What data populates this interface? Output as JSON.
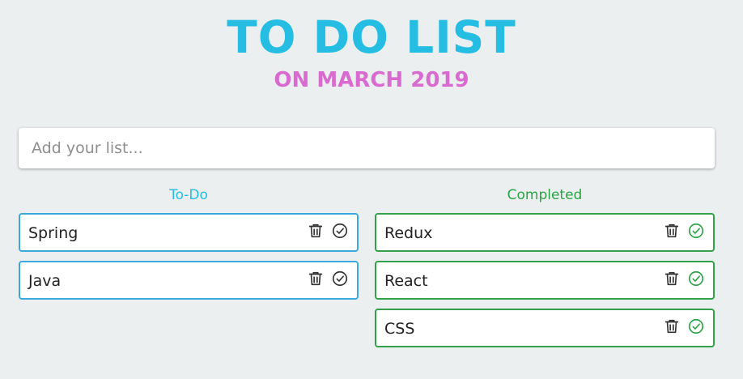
{
  "header": {
    "title": "TO DO LIST",
    "subtitle": "ON MARCH 2019"
  },
  "input": {
    "placeholder": "Add your list...",
    "value": ""
  },
  "todo": {
    "heading": "To-Do",
    "items": [
      {
        "text": "Spring"
      },
      {
        "text": "Java"
      }
    ]
  },
  "completed": {
    "heading": "Completed",
    "items": [
      {
        "text": "Redux"
      },
      {
        "text": "React"
      },
      {
        "text": "CSS"
      }
    ]
  },
  "icons": {
    "delete": "trash-icon",
    "complete": "check-circle-icon"
  },
  "colors": {
    "background": "#eceff0",
    "title": "#26bde3",
    "subtitle": "#d86ad0",
    "todo_accent": "#3aa9df",
    "completed_accent": "#33a04a",
    "todo_check": "#333333",
    "completed_check": "#2aa344"
  }
}
